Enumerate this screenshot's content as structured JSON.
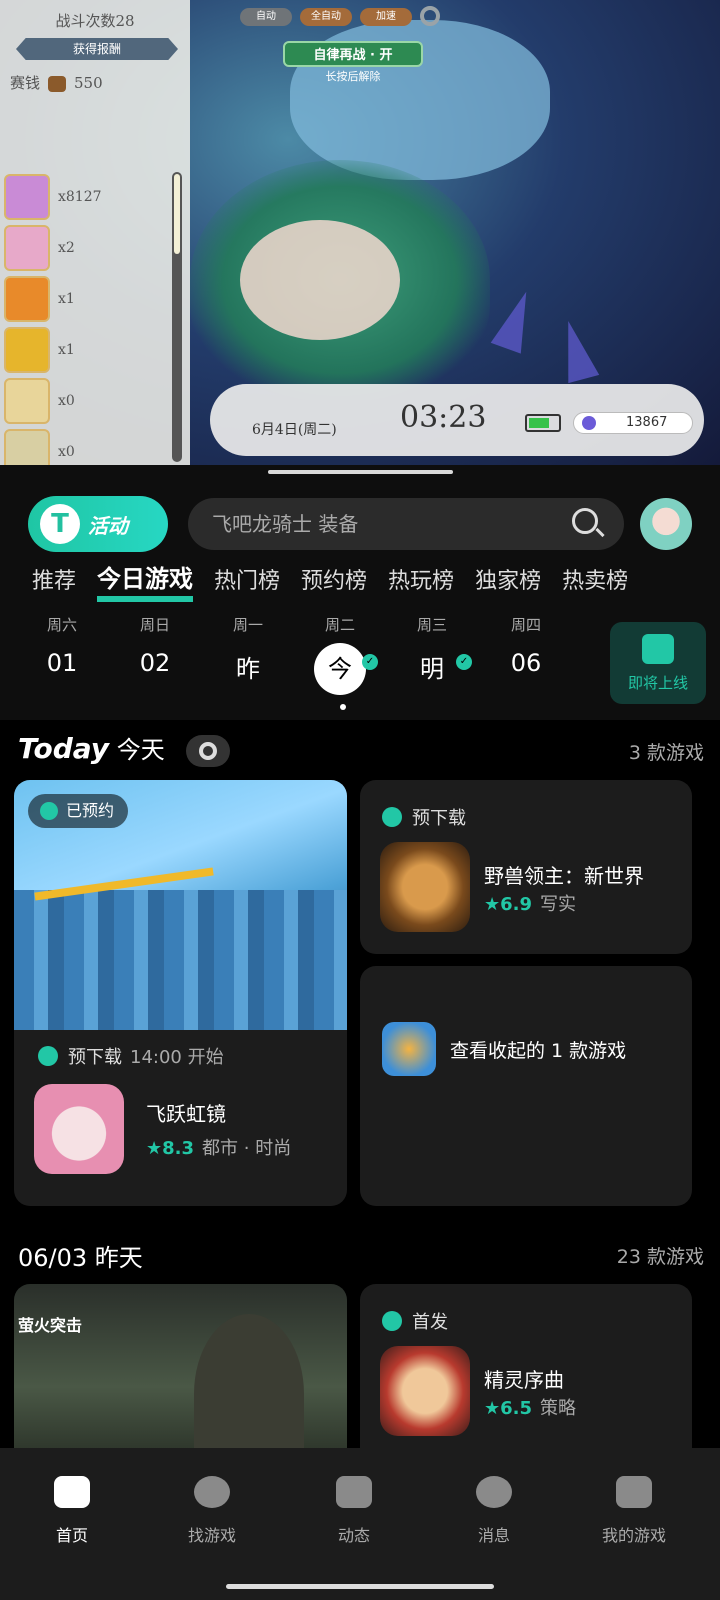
{
  "game": {
    "battle_count": "战斗次数28",
    "reward_banner": "获得报酬",
    "coins_label": "赛钱",
    "coins_value": "550",
    "items": [
      {
        "count": "x8127",
        "color": "#c98bd6"
      },
      {
        "count": "x2",
        "color": "#e7a9c9"
      },
      {
        "count": "x1",
        "color": "#e88a2a"
      },
      {
        "count": "x1",
        "color": "#e6b52c"
      },
      {
        "count": "x0",
        "color": "#e8d59a"
      },
      {
        "count": "x0",
        "color": "#d8cfa3"
      }
    ],
    "controls": [
      "自动",
      "全自动",
      "加速"
    ],
    "auto_battle": "自律再战 · 开",
    "auto_hint": "长按后解除",
    "date": "6月4日(周二)",
    "clock": "03:23",
    "gems": "13867"
  },
  "header": {
    "logo_text": "活动",
    "search_placeholder": "飞吧龙骑士 装备"
  },
  "tabs": [
    "推荐",
    "今日游戏",
    "热门榜",
    "预约榜",
    "热玩榜",
    "独家榜",
    "热卖榜"
  ],
  "days": [
    {
      "week": "周六",
      "date": "01"
    },
    {
      "week": "周日",
      "date": "02"
    },
    {
      "week": "周一",
      "date": "昨"
    },
    {
      "week": "周二",
      "date": "今"
    },
    {
      "week": "周三",
      "date": "明"
    },
    {
      "week": "周四",
      "date": "06"
    }
  ],
  "upcoming_label": "即将上线",
  "today": {
    "title_en": "Today",
    "title_cn": "今天",
    "count": "3 款游戏",
    "reserved": "已预约",
    "featured": {
      "status": "预下载",
      "time": "14:00 开始",
      "name": "飞跃虹镜",
      "rating": "8.3",
      "tags": "都市 · 时尚"
    },
    "side_card": {
      "status": "预下载",
      "name": "野兽领主：新世界",
      "rating": "6.9",
      "tags": "写实"
    },
    "collapsed": "查看收起的 1 款游戏"
  },
  "yesterday": {
    "title": "06/03 昨天",
    "count": "23 款游戏",
    "logo": "萤火突击",
    "side_card": {
      "status": "首发",
      "name": "精灵序曲",
      "rating": "6.5",
      "tags": "策略"
    }
  },
  "nav": [
    "首页",
    "找游戏",
    "动态",
    "消息",
    "我的游戏"
  ],
  "colors": {
    "accent": "#22c7a6",
    "background": "#0e0e0e",
    "card": "#1c1c1c"
  }
}
